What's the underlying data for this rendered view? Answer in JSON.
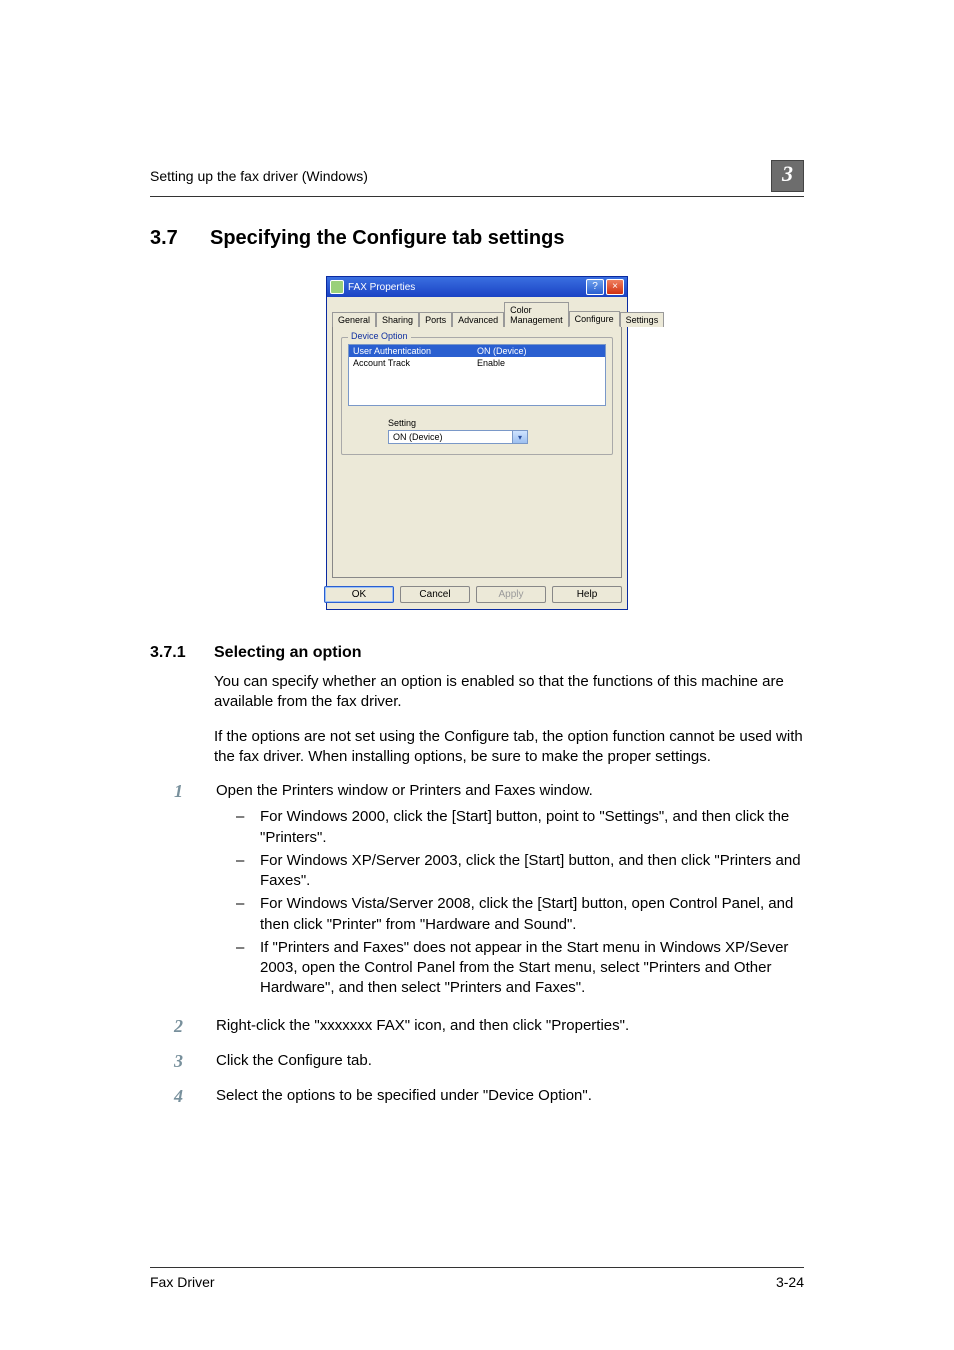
{
  "header": {
    "running_title": "Setting up the fax driver (Windows)",
    "chapter_badge": "3"
  },
  "section": {
    "num": "3.7",
    "title": "Specifying the Configure tab settings"
  },
  "dialog": {
    "title_suffix": "FAX Properties",
    "tabs": [
      "General",
      "Sharing",
      "Ports",
      "Advanced",
      "Color Management",
      "Configure",
      "Settings"
    ],
    "active_tab": "Configure",
    "group_title": "Device Option",
    "list": [
      {
        "name": "User Authentication",
        "value": "ON (Device)",
        "selected": true
      },
      {
        "name": "Account Track",
        "value": "Enable",
        "selected": false
      }
    ],
    "setting_label": "Setting",
    "setting_value": "ON (Device)",
    "buttons": {
      "ok": "OK",
      "cancel": "Cancel",
      "apply": "Apply",
      "help": "Help"
    }
  },
  "subsection": {
    "num": "3.7.1",
    "title": "Selecting an option"
  },
  "para1": "You can specify whether an option is enabled so that the functions of this machine are available from the fax driver.",
  "para2": "If the options are not set using the Configure tab, the option function cannot be used with the fax driver. When installing options, be sure to make the proper settings.",
  "steps": {
    "s1": {
      "text": "Open the Printers window or Printers and Faxes window.",
      "bullets": [
        "For Windows 2000, click the [Start] button, point to \"Settings\", and then click the \"Printers\".",
        "For Windows XP/Server 2003, click the [Start] button, and then click \"Printers and Faxes\".",
        "For Windows Vista/Server 2008, click the [Start] button, open Control Panel, and then click \"Printer\" from \"Hardware and Sound\".",
        "If \"Printers and Faxes\" does not appear in the Start menu in Windows XP/Sever 2003, open the Control Panel from the Start menu, select \"Printers and Other Hardware\", and then select \"Printers and Faxes\"."
      ]
    },
    "s2": "Right-click the \"xxxxxxx FAX\" icon, and then click \"Properties\".",
    "s3": "Click the Configure tab.",
    "s4": "Select the options to be specified under \"Device Option\"."
  },
  "footer": {
    "left": "Fax Driver",
    "right": "3-24"
  }
}
